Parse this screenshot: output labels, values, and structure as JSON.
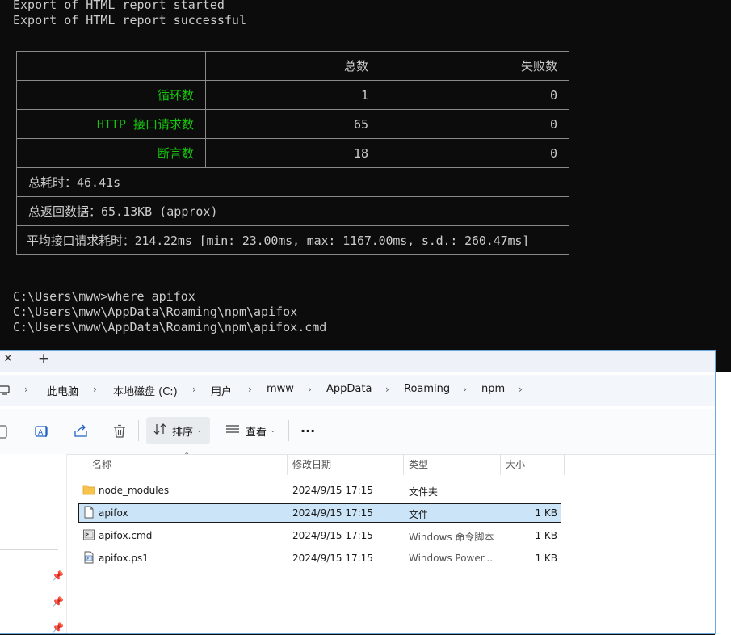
{
  "terminal": {
    "lines_top": [
      "Export of HTML report started",
      "Export of HTML report successful"
    ],
    "table": {
      "header": [
        "",
        "总数",
        "失败数"
      ],
      "rows": [
        {
          "label": "循环数",
          "total": "1",
          "failed": "0"
        },
        {
          "label": "HTTP 接口请求数",
          "total": "65",
          "failed": "0"
        },
        {
          "label": "断言数",
          "total": "18",
          "failed": "0"
        }
      ],
      "summary": [
        "总耗时：46.41s",
        "总返回数据：65.13KB (approx)",
        "平均接口请求耗时：214.22ms [min: 23.00ms, max: 1167.00ms, s.d.: 260.47ms]"
      ]
    },
    "lines_bottom": [
      "C:\\Users\\mww>where apifox",
      "C:\\Users\\mww\\AppData\\Roaming\\npm\\apifox",
      "C:\\Users\\mww\\AppData\\Roaming\\npm\\apifox.cmd"
    ]
  },
  "explorer": {
    "tab": {
      "close_glyph": "✕",
      "new_glyph": "+"
    },
    "breadcrumb": [
      "此电脑",
      "本地磁盘 (C:)",
      "用户",
      "mww",
      "AppData",
      "Roaming",
      "npm"
    ],
    "toolbar": {
      "sort_label": "排序",
      "view_label": "查看",
      "more_label": "···"
    },
    "columns": {
      "name": "名称",
      "modified": "修改日期",
      "type": "类型",
      "size": "大小"
    },
    "files": [
      {
        "name": "node_modules",
        "modified": "2024/9/15 17:15",
        "type": "文件夹",
        "size": "",
        "icon": "folder-icon"
      },
      {
        "name": "apifox",
        "modified": "2024/9/15 17:15",
        "type": "文件",
        "size": "1 KB",
        "icon": "file-icon",
        "selected": true
      },
      {
        "name": "apifox.cmd",
        "modified": "2024/9/15 17:15",
        "type": "Windows 命令脚本",
        "size": "1 KB",
        "icon": "cmd-script-icon"
      },
      {
        "name": "apifox.ps1",
        "modified": "2024/9/15 17:15",
        "type": "Windows Power...",
        "size": "1 KB",
        "icon": "powershell-script-icon"
      }
    ],
    "colors": {
      "accent": "#16c60c",
      "selection": "#cce4f7",
      "folder": "#f8c34a"
    }
  }
}
